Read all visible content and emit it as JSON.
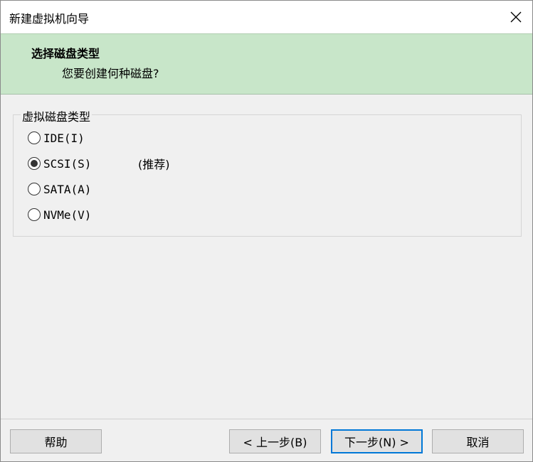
{
  "window": {
    "title": "新建虚拟机向导"
  },
  "header": {
    "title": "选择磁盘类型",
    "subtitle": "您要创建何种磁盘?"
  },
  "group": {
    "legend": "虚拟磁盘类型",
    "options": [
      {
        "label": "IDE(I)",
        "selected": false
      },
      {
        "label": "SCSI(S)",
        "selected": true,
        "note": "(推荐)"
      },
      {
        "label": "SATA(A)",
        "selected": false
      },
      {
        "label": "NVMe(V)",
        "selected": false
      }
    ]
  },
  "buttons": {
    "help": "帮助",
    "back": "< 上一步(B)",
    "next": "下一步(N) >",
    "cancel": "取消"
  },
  "icons": {
    "close": "close-icon"
  }
}
